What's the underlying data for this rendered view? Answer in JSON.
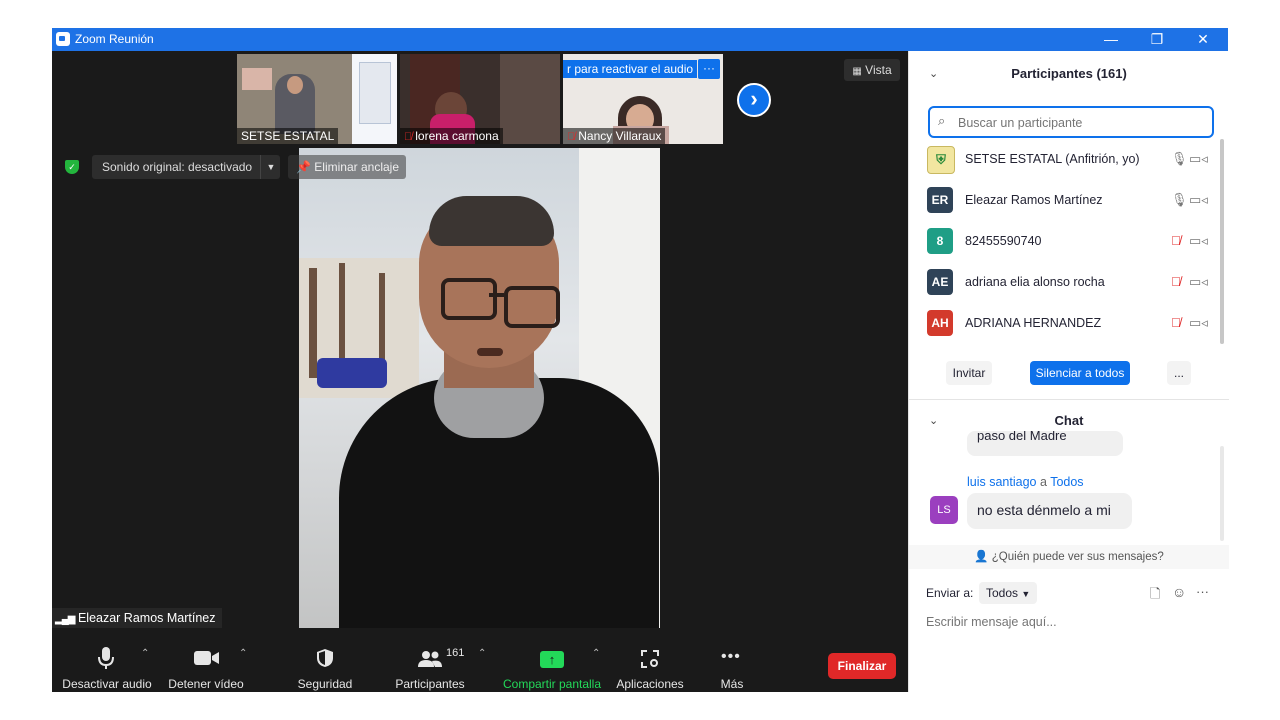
{
  "window": {
    "title": "Zoom Reunión",
    "minimize": "—",
    "restore": "❐",
    "close": "✕"
  },
  "video": {
    "view_label": "Vista",
    "thumbnails": [
      {
        "name": "SETSE ESTATAL",
        "muted": false
      },
      {
        "name": "lorena carmona",
        "muted": true
      },
      {
        "name": "Nancy Villaraux",
        "muted": true,
        "banner": "r para reactivar el audio",
        "more": "···"
      }
    ],
    "next_arrow": "›",
    "sound_original": "Sonido original: desactivado",
    "unpin": "Eliminar anclaje",
    "active_speaker": "Eleazar Ramos Martínez"
  },
  "toolbar": {
    "audio": "Desactivar audio",
    "video": "Detener vídeo",
    "security": "Seguridad",
    "participants": "Participantes",
    "participants_count": "161",
    "share": "Compartir pantalla",
    "apps": "Aplicaciones",
    "more": "Más",
    "end": "Finalizar"
  },
  "participants_panel": {
    "title": "Participantes (161)",
    "search_placeholder": "Buscar un participante",
    "list": [
      {
        "initials": "",
        "name": "SETSE ESTATAL (Anfitrión, yo)",
        "color": "#f2e6a0",
        "mic": "on"
      },
      {
        "initials": "ER",
        "name": "Eleazar Ramos Martínez",
        "color": "#2f4358",
        "mic": "on"
      },
      {
        "initials": "8",
        "name": "82455590740",
        "color": "#1f9e86",
        "mic": "muted"
      },
      {
        "initials": "AE",
        "name": "adriana elia alonso rocha",
        "color": "#2f4358",
        "mic": "muted"
      },
      {
        "initials": "AH",
        "name": "ADRIANA HERNANDEZ",
        "color": "#d33a2c",
        "mic": "muted"
      }
    ],
    "invite": "Invitar",
    "mute_all": "Silenciar a todos",
    "more": "..."
  },
  "chat": {
    "title": "Chat",
    "prev_message_fragment": "paso del Madre",
    "sender": "luis santiago",
    "to_word": "a",
    "recipient": "Todos",
    "sender_initials": "LS",
    "sender_color": "#9b3fbf",
    "message": "no esta dénmelo a mi",
    "who_can_see": "¿Quién puede ver sus mensajes?",
    "send_to_label": "Enviar a:",
    "send_to_value": "Todos",
    "input_placeholder": "Escribir mensaje aquí..."
  },
  "colors": {
    "accent": "#0e71eb",
    "end_button": "#e02828",
    "share_green": "#23d959"
  }
}
